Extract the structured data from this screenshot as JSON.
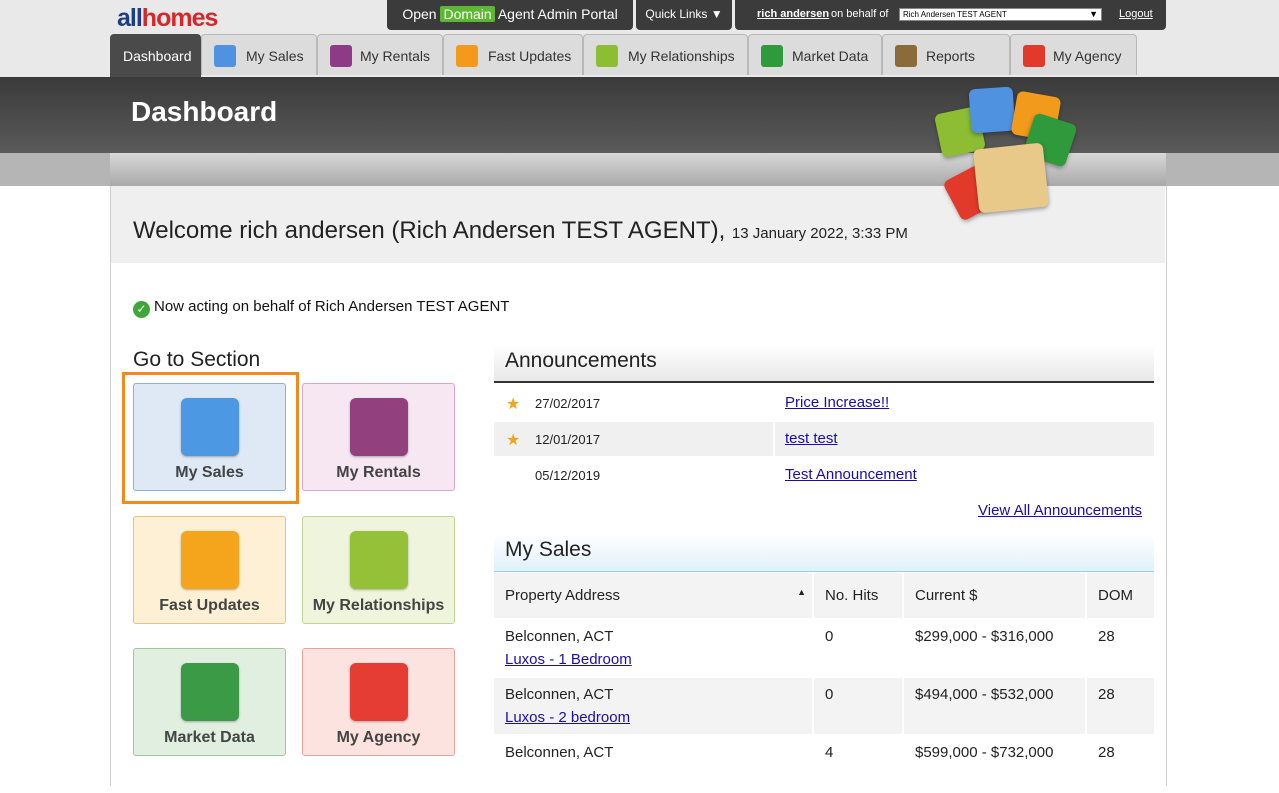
{
  "logo": {
    "part1": "all",
    "part2": "homes"
  },
  "topbar": {
    "portal_prefix": "Open",
    "portal_brand": "Domain",
    "portal_suffix": "Agent Admin Portal",
    "quick_links": "Quick Links ▼",
    "user_name": "rich andersen",
    "on_behalf": "on behalf of",
    "agent_selected": "Rich Andersen TEST AGENT",
    "logout": "Logout"
  },
  "tabs": [
    {
      "label": "Dashboard",
      "icon": "",
      "color": ""
    },
    {
      "label": "My Sales",
      "icon": "house-icon",
      "color": "#4f93e0"
    },
    {
      "label": "My Rentals",
      "icon": "building-icon",
      "color": "#8e3a86"
    },
    {
      "label": "Fast Updates",
      "icon": "arrow-up-icon",
      "color": "#f29a1c"
    },
    {
      "label": "My Relationships",
      "icon": "people-icon",
      "color": "#8cbd32"
    },
    {
      "label": "Market Data",
      "icon": "pie-chart-icon",
      "color": "#2f9a3c"
    },
    {
      "label": "Reports",
      "icon": "report-icon",
      "color": "#8c6a3a"
    },
    {
      "label": "My Agency",
      "icon": "person-icon",
      "color": "#e23a2a"
    }
  ],
  "dashboard_title": "Dashboard",
  "welcome": {
    "text": "Welcome rich andersen (Rich Andersen TEST AGENT),",
    "date": "13 January 2022, 3:33 PM"
  },
  "acting_message": "Now acting on behalf of Rich Andersen TEST AGENT",
  "goto": {
    "title": "Go to Section",
    "tiles": [
      {
        "label": "My Sales",
        "icon": "house-icon",
        "color": "#4d98e3"
      },
      {
        "label": "My Rentals",
        "icon": "building-icon",
        "color": "#93407f"
      },
      {
        "label": "Fast Updates",
        "icon": "arrow-up-icon",
        "color": "#f5a51c"
      },
      {
        "label": "My Relationships",
        "icon": "people-icon",
        "color": "#95c139"
      },
      {
        "label": "Market Data",
        "icon": "pie-chart-icon",
        "color": "#3a9a46"
      },
      {
        "label": "My Agency",
        "icon": "person-icon",
        "color": "#e53c33"
      }
    ]
  },
  "announcements": {
    "title": "Announcements",
    "items": [
      {
        "date": "27/02/2017",
        "title": "Price Increase!!",
        "starred": true
      },
      {
        "date": "12/01/2017",
        "title": "test test",
        "starred": true
      },
      {
        "date": "05/12/2019",
        "title": "Test Announcement",
        "starred": false
      }
    ],
    "view_all": "View All Announcements"
  },
  "my_sales": {
    "title": "My Sales",
    "columns": [
      "Property Address",
      "No. Hits",
      "Current $",
      "DOM"
    ],
    "rows": [
      {
        "suburb": "Belconnen, ACT",
        "listing": "Luxos - 1 Bedroom",
        "hits": "0",
        "price": "$299,000 - $316,000",
        "dom": "28"
      },
      {
        "suburb": "Belconnen, ACT",
        "listing": "Luxos - 2 bedroom",
        "hits": "0",
        "price": "$494,000 - $532,000",
        "dom": "28"
      },
      {
        "suburb": "Belconnen, ACT",
        "listing": "",
        "hits": "4",
        "price": "$599,000 - $732,000",
        "dom": "28"
      }
    ]
  }
}
